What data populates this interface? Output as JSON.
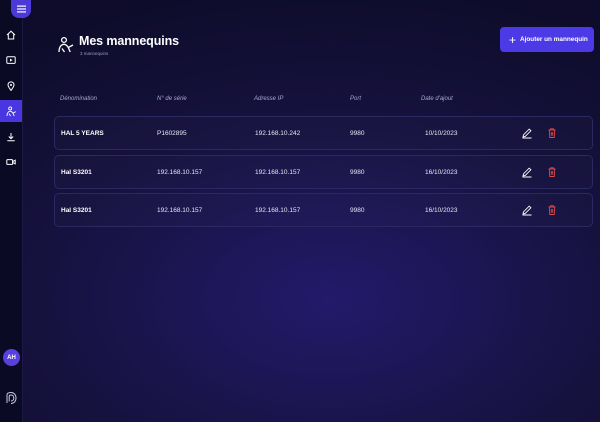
{
  "page": {
    "title": "Mes mannequins",
    "subtitle": "3 mannequins"
  },
  "actions": {
    "add_label": "Ajouter un mannequin"
  },
  "sidebar": {
    "avatar_initials": "AH",
    "items": [
      {
        "icon": "home-icon"
      },
      {
        "icon": "video-library-icon"
      },
      {
        "icon": "location-pin-icon"
      },
      {
        "icon": "mannequin-icon",
        "active": true
      },
      {
        "icon": "download-icon"
      },
      {
        "icon": "camera-icon"
      }
    ]
  },
  "table": {
    "columns": [
      "Dénomination",
      "N° de série",
      "Adresse IP",
      "Port",
      "Date d'ajout"
    ],
    "rows": [
      {
        "name": "HAL 5 YEARS",
        "serial": "P1602895",
        "ip": "192.168.10.242",
        "port": "9980",
        "date": "10/10/2023"
      },
      {
        "name": "Hal S3201",
        "serial": "192.168.10.157",
        "ip": "192.168.10.157",
        "port": "9980",
        "date": "16/10/2023"
      },
      {
        "name": "Hal S3201",
        "serial": "192.168.10.157",
        "ip": "192.168.10.157",
        "port": "9980",
        "date": "16/10/2023"
      }
    ]
  },
  "colors": {
    "accent": "#4c3ae6",
    "delete": "#e04848",
    "sidebar_bg": "#0b0a24"
  }
}
